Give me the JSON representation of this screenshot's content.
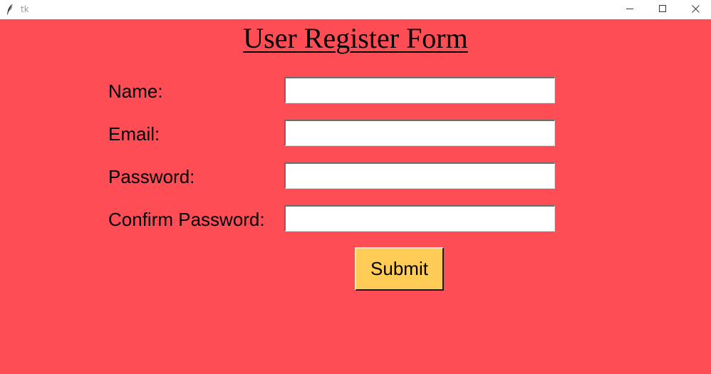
{
  "window": {
    "title": "tk",
    "icons": {
      "app": "feather-icon",
      "minimize": "minimize-icon",
      "maximize": "maximize-icon",
      "close": "close-icon"
    }
  },
  "form": {
    "title": "User Register Form",
    "background_color": "#ff4d55",
    "fields": [
      {
        "label": "Name:",
        "value": ""
      },
      {
        "label": "Email:",
        "value": ""
      },
      {
        "label": "Password:",
        "value": ""
      },
      {
        "label": "Confirm Password:",
        "value": ""
      }
    ],
    "submit_label": "Submit",
    "submit_color": "#ffcc55"
  }
}
